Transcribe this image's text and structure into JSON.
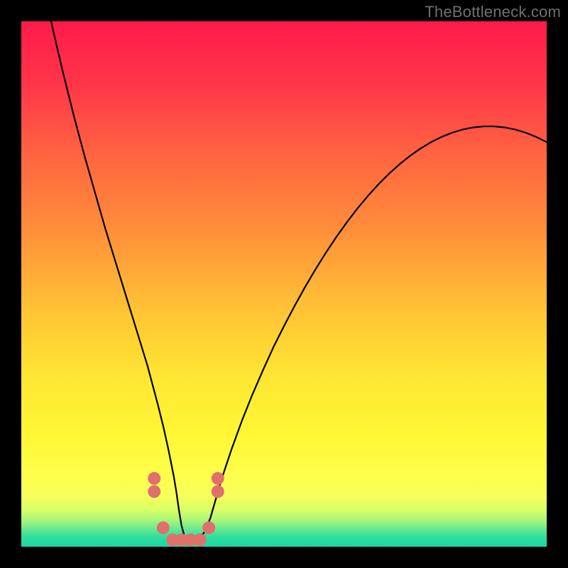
{
  "watermark": "TheBottleneck.com",
  "chart_data": {
    "type": "line",
    "title": "",
    "xlabel": "",
    "ylabel": "",
    "xlim": [
      0,
      100
    ],
    "ylim": [
      0,
      100
    ],
    "x": [
      0,
      2,
      4,
      6,
      8,
      10,
      12,
      14,
      16,
      18,
      20,
      22,
      24,
      26,
      27,
      28,
      29,
      29.5,
      30,
      30.5,
      31,
      31.5,
      32,
      32.5,
      33,
      33.5,
      34,
      35,
      36,
      37,
      38,
      40,
      42,
      44,
      46,
      48,
      50,
      52,
      54,
      56,
      58,
      60,
      62,
      64,
      66,
      68,
      70,
      72,
      74,
      76,
      78,
      80,
      82,
      84,
      86,
      88,
      90,
      92,
      94,
      96,
      98,
      100
    ],
    "values": [
      140,
      120,
      108,
      98.5,
      90,
      82,
      74.5,
      67.5,
      60.5,
      54,
      47.5,
      41,
      34.5,
      27,
      23,
      18.5,
      13.5,
      10.5,
      7,
      4,
      2.2,
      1.4,
      1.0,
      1.0,
      1.0,
      1.2,
      1.6,
      3.0,
      5.5,
      9.0,
      12.5,
      18.5,
      24.0,
      29.0,
      33.6,
      38.0,
      42.0,
      45.8,
      49.4,
      52.8,
      56.0,
      59.0,
      61.8,
      64.4,
      66.8,
      69.0,
      71.0,
      72.8,
      74.4,
      75.8,
      77.0,
      78.0,
      78.8,
      79.4,
      79.8,
      80.0,
      80.0,
      79.8,
      79.4,
      78.8,
      78.0,
      77.0
    ],
    "gradient_stops": [
      {
        "pos": 0.0,
        "color": "#ff1a49"
      },
      {
        "pos": 0.12,
        "color": "#ff364a"
      },
      {
        "pos": 0.25,
        "color": "#ff6341"
      },
      {
        "pos": 0.4,
        "color": "#ff8f3a"
      },
      {
        "pos": 0.55,
        "color": "#ffc335"
      },
      {
        "pos": 0.68,
        "color": "#ffe733"
      },
      {
        "pos": 0.78,
        "color": "#fff634"
      },
      {
        "pos": 0.86,
        "color": "#fffe4a"
      },
      {
        "pos": 0.905,
        "color": "#f6ff5c"
      },
      {
        "pos": 0.93,
        "color": "#d9ff66"
      },
      {
        "pos": 0.95,
        "color": "#a6f57a"
      },
      {
        "pos": 0.965,
        "color": "#6fe98e"
      },
      {
        "pos": 0.98,
        "color": "#34de9e"
      },
      {
        "pos": 1.0,
        "color": "#18d8a8"
      }
    ],
    "dots": {
      "color": "#e0706c",
      "radius_px": 9,
      "points_xy": [
        [
          25.3,
          13.0
        ],
        [
          25.3,
          10.5
        ],
        [
          27.0,
          3.6
        ],
        [
          28.8,
          1.3
        ],
        [
          30.5,
          1.3
        ],
        [
          32.2,
          1.3
        ],
        [
          34.0,
          1.3
        ],
        [
          35.7,
          3.6
        ],
        [
          37.4,
          10.5
        ],
        [
          37.4,
          13.0
        ]
      ]
    }
  }
}
